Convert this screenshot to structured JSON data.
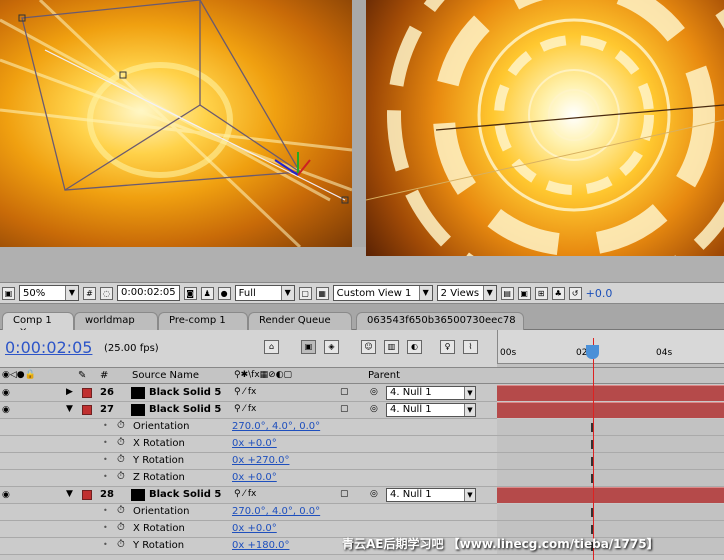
{
  "viewer_toolbar": {
    "zoom": "50%",
    "timecode": "0:00:02:05",
    "resolution": "Full",
    "view": "Custom View 1",
    "layout": "2 Views",
    "exposure": "+0.0"
  },
  "tabs": [
    {
      "label": "Comp 1",
      "close": "×"
    },
    {
      "label": "worldmap"
    },
    {
      "label": "Pre-comp 1"
    },
    {
      "label": "Render Queue"
    },
    {
      "label": "063543f650b36500730eec78"
    }
  ],
  "timeline": {
    "current_time": "0:00:02:05",
    "fps": "(25.00 fps)",
    "ruler_ticks": [
      "00s",
      "02",
      "04s"
    ]
  },
  "columns": {
    "num": "#",
    "source": "Source Name",
    "parent": "Parent"
  },
  "rows": [
    {
      "type": "layer",
      "num": "26",
      "name": "Black Solid 5",
      "parent": "4. Null 1",
      "expanded": false
    },
    {
      "type": "layer",
      "num": "27",
      "name": "Black Solid 5",
      "parent": "4. Null 1",
      "expanded": true
    },
    {
      "type": "prop",
      "name": "Orientation",
      "value": "270.0°, 4.0°, 0.0°"
    },
    {
      "type": "prop",
      "name": "X Rotation",
      "value": "0x +0.0°"
    },
    {
      "type": "prop",
      "name": "Y Rotation",
      "value": "0x +270.0°"
    },
    {
      "type": "prop",
      "name": "Z Rotation",
      "value": "0x +0.0°"
    },
    {
      "type": "layer",
      "num": "28",
      "name": "Black Solid 5",
      "parent": "4. Null 1",
      "expanded": true
    },
    {
      "type": "prop",
      "name": "Orientation",
      "value": "270.0°, 4.0°, 0.0°"
    },
    {
      "type": "prop",
      "name": "X Rotation",
      "value": "0x +0.0°"
    },
    {
      "type": "prop",
      "name": "Y Rotation",
      "value": "0x +180.0°"
    }
  ],
  "watermark": "青云AE后期学习吧 【www.linecg.com/tieba/1775】",
  "colors": {
    "accent": "#2d55c8",
    "layer_bar": "#b54a4a",
    "cti": "#dd2222"
  }
}
